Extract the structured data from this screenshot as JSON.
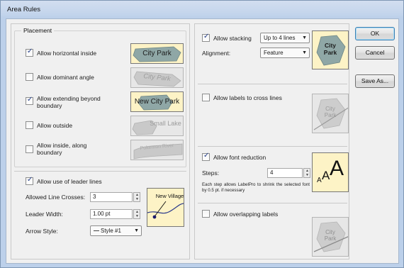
{
  "window": {
    "title": "Area Rules"
  },
  "placement": {
    "legend": "Placement",
    "options": [
      {
        "label": "Allow horizontal inside",
        "checked": true,
        "preview": "City Park",
        "preview_active": true
      },
      {
        "label": "Allow dominant angle",
        "checked": false,
        "preview": "City Park",
        "preview_active": false
      },
      {
        "label": "Allow extending beyond boundary",
        "checked": true,
        "preview": "New City Park",
        "preview_active": true
      },
      {
        "label": "Allow outside",
        "checked": false,
        "preview": "Small Lake",
        "preview_active": false
      },
      {
        "label": "Allow inside, along boundary",
        "checked": false,
        "preview": "Pokemon River",
        "preview_active": false
      }
    ]
  },
  "leader": {
    "label": "Allow use of leader lines",
    "checked": true,
    "crosses_label": "Allowed Line Crosses:",
    "crosses_value": "3",
    "width_label": "Leader Width:",
    "width_value": "1.00 pt",
    "arrow_label": "Arrow Style:",
    "arrow_value": "Style #1",
    "preview": "New Village"
  },
  "stacking": {
    "label": "Allow stacking",
    "checked": true,
    "stack_value": "Up to 4 lines",
    "alignment_label": "Alignment:",
    "alignment_value": "Feature",
    "preview_line1": "City",
    "preview_line2": "Park"
  },
  "cross_lines": {
    "label": "Allow labels to cross lines",
    "checked": false,
    "preview_line1": "City",
    "preview_line2": "Park"
  },
  "font_reduction": {
    "label": "Allow font reduction",
    "checked": true,
    "steps_label": "Steps:",
    "steps_value": "4",
    "description": "Each step allows LabelPro to shrink the selected font by 0.5 pt. if necessary",
    "preview_glyphs": [
      "A",
      "A",
      "A"
    ]
  },
  "overlapping": {
    "label": "Allow overlapping labels",
    "checked": false,
    "preview_line1": "City",
    "preview_line2": "Park"
  },
  "buttons": {
    "ok": "OK",
    "cancel": "Cancel",
    "save_as": "Save As..."
  },
  "glyphs": {
    "check": "✓",
    "dropdown": "▼",
    "spin_up": "▲",
    "spin_down": "▼"
  },
  "colors": {
    "preview_active_bg": "#fdf3c6",
    "preview_inactive_bg": "#e7e7e7",
    "polygon_active": "#8fa7a6",
    "default_button_border": "#3c7fb1"
  }
}
